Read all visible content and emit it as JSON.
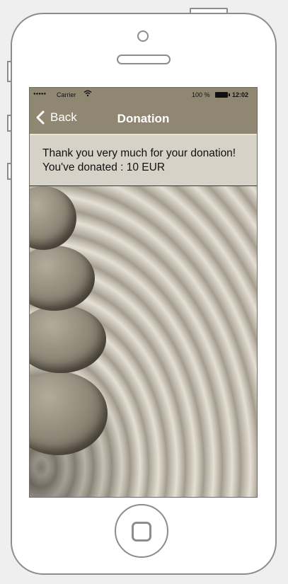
{
  "status_bar": {
    "signal": "●●●●●",
    "carrier": "Carrier",
    "battery": "100 %",
    "time": "12:02"
  },
  "nav": {
    "back_label": "Back",
    "title": "Donation"
  },
  "message": {
    "line1": "Thank you very much for your donation!",
    "line2": "You've donated : 10 EUR"
  },
  "icons": {
    "wifi": "wifi-icon",
    "battery": "battery-icon",
    "back": "chevron-left-icon"
  },
  "colors": {
    "nav_bar": "#8f8772",
    "message_bg": "#d6d2c8"
  }
}
